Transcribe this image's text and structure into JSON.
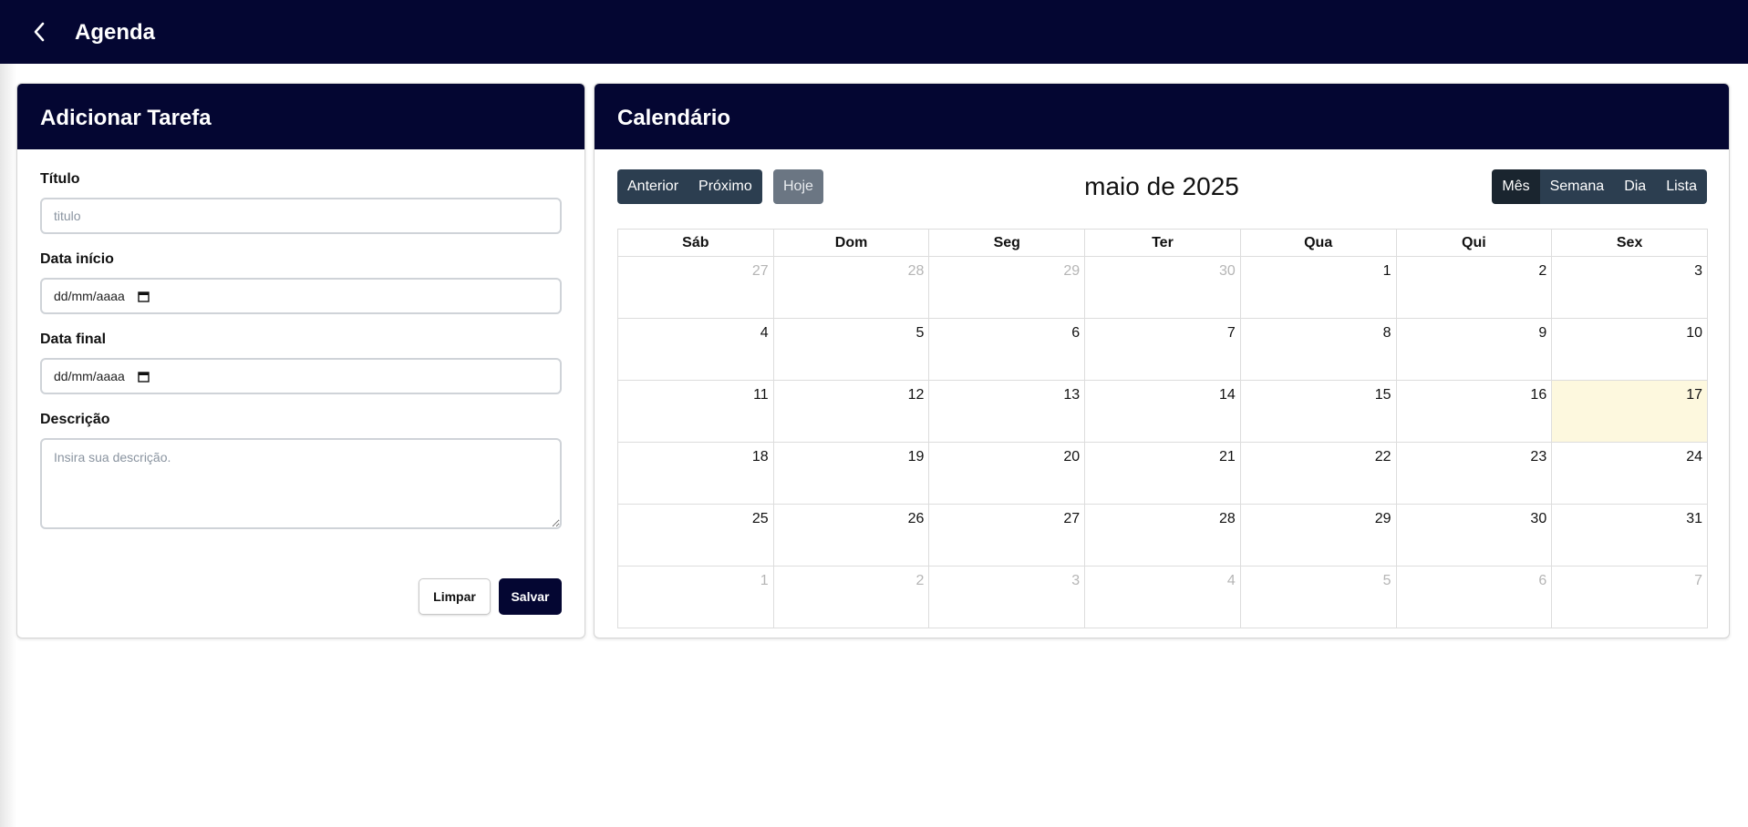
{
  "app": {
    "title": "Agenda"
  },
  "form": {
    "header": "Adicionar Tarefa",
    "title_label": "Título",
    "title_placeholder": "titulo",
    "start_label": "Data início",
    "start_placeholder": "dd/mm/aaaa",
    "end_label": "Data final",
    "end_placeholder": "dd/mm/aaaa",
    "description_label": "Descrição",
    "description_placeholder": "Insira sua descrição.",
    "clear_label": "Limpar",
    "save_label": "Salvar"
  },
  "calendar": {
    "header": "Calendário",
    "prev_label": "Anterior",
    "next_label": "Próximo",
    "today_label": "Hoje",
    "month_title": "maio de 2025",
    "views": [
      "Mês",
      "Semana",
      "Dia",
      "Lista"
    ],
    "active_view": "Mês",
    "weekdays": [
      "Sáb",
      "Dom",
      "Seg",
      "Ter",
      "Qua",
      "Qui",
      "Sex"
    ],
    "today_highlight_color": "#fdf8de",
    "weeks": [
      [
        {
          "d": "27",
          "o": true
        },
        {
          "d": "28",
          "o": true
        },
        {
          "d": "29",
          "o": true
        },
        {
          "d": "30",
          "o": true
        },
        {
          "d": "1"
        },
        {
          "d": "2"
        },
        {
          "d": "3"
        }
      ],
      [
        {
          "d": "4"
        },
        {
          "d": "5"
        },
        {
          "d": "6"
        },
        {
          "d": "7"
        },
        {
          "d": "8"
        },
        {
          "d": "9"
        },
        {
          "d": "10"
        }
      ],
      [
        {
          "d": "11"
        },
        {
          "d": "12"
        },
        {
          "d": "13"
        },
        {
          "d": "14"
        },
        {
          "d": "15"
        },
        {
          "d": "16"
        },
        {
          "d": "17",
          "t": true
        }
      ],
      [
        {
          "d": "18"
        },
        {
          "d": "19"
        },
        {
          "d": "20"
        },
        {
          "d": "21"
        },
        {
          "d": "22"
        },
        {
          "d": "23"
        },
        {
          "d": "24"
        }
      ],
      [
        {
          "d": "25"
        },
        {
          "d": "26"
        },
        {
          "d": "27"
        },
        {
          "d": "28"
        },
        {
          "d": "29"
        },
        {
          "d": "30"
        },
        {
          "d": "31"
        }
      ],
      [
        {
          "d": "1",
          "o": true
        },
        {
          "d": "2",
          "o": true
        },
        {
          "d": "3",
          "o": true
        },
        {
          "d": "4",
          "o": true
        },
        {
          "d": "5",
          "o": true
        },
        {
          "d": "6",
          "o": true
        },
        {
          "d": "7",
          "o": true
        }
      ]
    ]
  },
  "colors": {
    "navy": "#040632",
    "toolbar": "#2c3e50",
    "toolbar_active": "#1a252f"
  }
}
